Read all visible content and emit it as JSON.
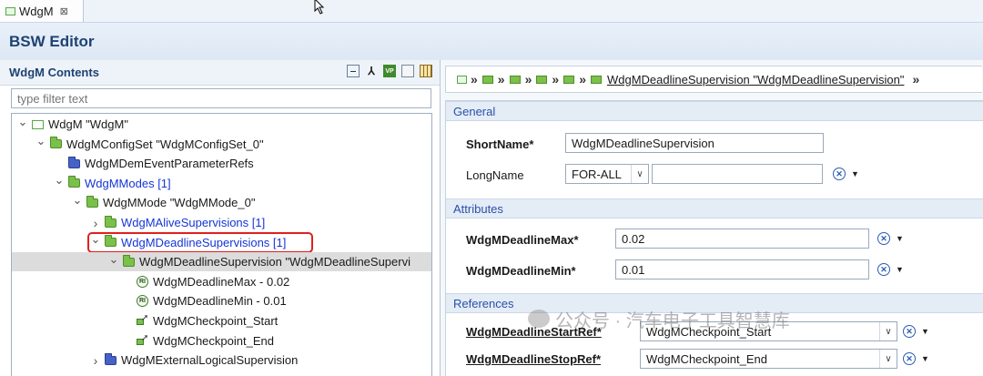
{
  "tab": {
    "label": "WdgM",
    "close": "⊠"
  },
  "editor": {
    "title": "BSW Editor"
  },
  "left": {
    "title": "WdgM Contents",
    "filter_placeholder": "type filter text",
    "toolbar": [
      "collapse-all-icon",
      "link-icon",
      "vp-icon",
      "document-icon",
      "grid-icon"
    ],
    "tree": [
      {
        "label": "WdgM \"WdgM\"",
        "twisty": "v",
        "icon": "module",
        "color": "default",
        "selected": false,
        "highlighted": false
      },
      {
        "label": "WdgMConfigSet \"WdgMConfigSet_0\"",
        "twisty": "v",
        "icon": "folder-green",
        "color": "default",
        "selected": false,
        "highlighted": false
      },
      {
        "label": "WdgMDemEventParameterRefs",
        "twisty": "",
        "icon": "folder-blue",
        "color": "default",
        "selected": false,
        "highlighted": false
      },
      {
        "label": "WdgMModes [1]",
        "twisty": "v",
        "icon": "folder-green",
        "color": "blue",
        "selected": false,
        "highlighted": false
      },
      {
        "label": "WdgMMode \"WdgMMode_0\"",
        "twisty": "v",
        "icon": "folder-green",
        "color": "default",
        "selected": false,
        "highlighted": false
      },
      {
        "label": "WdgMAliveSupervisions [1]",
        "twisty": ">",
        "icon": "folder-green",
        "color": "blue",
        "selected": false,
        "highlighted": false
      },
      {
        "label": "WdgMDeadlineSupervisions [1]",
        "twisty": "v",
        "icon": "folder-green",
        "color": "blue",
        "selected": false,
        "highlighted": true
      },
      {
        "label": "WdgMDeadlineSupervision \"WdgMDeadlineSupervi",
        "twisty": "v",
        "icon": "folder-green",
        "color": "default",
        "selected": true,
        "highlighted": false
      },
      {
        "label": "WdgMDeadlineMax - 0.02",
        "twisty": "",
        "icon": "param",
        "color": "default",
        "selected": false,
        "highlighted": false
      },
      {
        "label": "WdgMDeadlineMin - 0.01",
        "twisty": "",
        "icon": "param",
        "color": "default",
        "selected": false,
        "highlighted": false
      },
      {
        "label": "WdgMCheckpoint_Start",
        "twisty": "",
        "icon": "ref",
        "color": "default",
        "selected": false,
        "highlighted": false
      },
      {
        "label": "WdgMCheckpoint_End",
        "twisty": "",
        "icon": "ref",
        "color": "default",
        "selected": false,
        "highlighted": false
      },
      {
        "label": "WdgMExternalLogicalSupervision",
        "twisty": ">",
        "icon": "folder-blue",
        "color": "default",
        "selected": false,
        "highlighted": false
      }
    ]
  },
  "right": {
    "breadcrumb": {
      "link": "WdgMDeadlineSupervision \"WdgMDeadlineSupervision\""
    },
    "sections": {
      "general": "General",
      "attributes": "Attributes",
      "references": "References"
    },
    "general": {
      "shortname_label": "ShortName*",
      "shortname_value": "WdgMDeadlineSupervision",
      "longname_label": "LongName",
      "longname_lang": "FOR-ALL",
      "longname_value": ""
    },
    "attributes": {
      "max_label": "WdgMDeadlineMax*",
      "max_value": "0.02",
      "min_label": "WdgMDeadlineMin*",
      "min_value": "0.01"
    },
    "references": {
      "start_label": "WdgMDeadlineStartRef*",
      "start_value": "WdgMCheckpoint_Start",
      "stop_label": "WdgMDeadlineStopRef*",
      "stop_value": "WdgMCheckpoint_End"
    }
  },
  "watermark": "公众号 · 汽车电子工具智慧库"
}
